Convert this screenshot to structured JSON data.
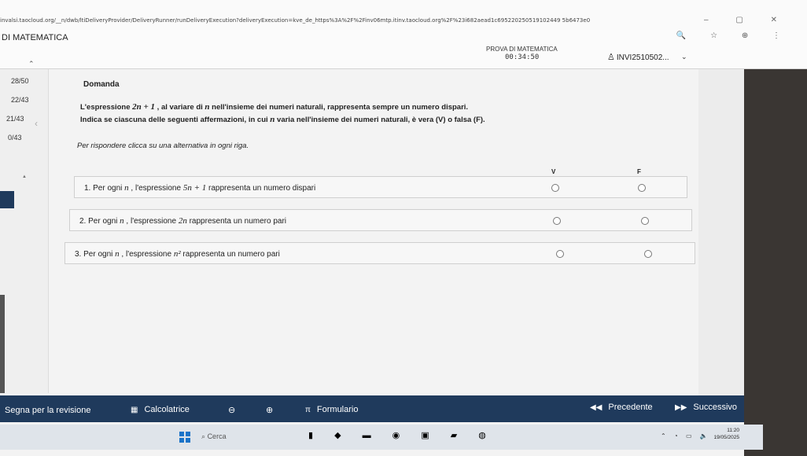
{
  "browser": {
    "url": "invalsi.taocloud.org/__n/dwb/ltiDeliveryProvider/DeliveryRunner/runDeliveryExecution?deliveryExecution=kve_de_https%3A%2F%2Finv06mtp.itinv.taocloud.org%2F%23i682aead1c695220250519102449 5b6473e0",
    "win_ctrls": "– ▢ ✕",
    "icons": "🔍 ☆ ⊕ ⋮"
  },
  "header": {
    "subject": "DI MATEMATICA",
    "test_title": "PROVA DI MATEMATICA",
    "timer": "00:34:50",
    "user": "INVI2510502...",
    "user_icon": "user-icon",
    "chevron": "⌄"
  },
  "sidebar": {
    "sections": [
      "28/50",
      "22/43",
      "21/43",
      "0/43"
    ],
    "up_arrow": "⌃",
    "collapse_arrow": "‹",
    "tiny_marker": "▲"
  },
  "question": {
    "title": "Domanda",
    "stem_line1_a": "L'espressione ",
    "stem_line1_math": "2n + 1",
    "stem_line1_b": " , al variare di ",
    "stem_line1_math2": "n",
    "stem_line1_c": " nell'insieme dei numeri naturali, rappresenta sempre un numero dispari.",
    "stem_line2_a": "Indica se ciascuna delle seguenti affermazioni, in cui ",
    "stem_line2_math": "n",
    "stem_line2_b": " varia nell'insieme dei numeri naturali, è vera (V) o falsa (F).",
    "instructions": "Per rispondere clicca su una alternativa in ogni riga.",
    "col_true": "V",
    "col_false": "F",
    "rows": [
      {
        "a": "1. Per ogni ",
        "m1": "n",
        "b": " , l'espressione ",
        "m2": "5n + 1",
        "c": " rappresenta un numero dispari"
      },
      {
        "a": "2. Per ogni ",
        "m1": "n",
        "b": " , l'espressione ",
        "m2": "2n",
        "c": " rappresenta un numero pari"
      },
      {
        "a": "3. Per ogni ",
        "m1": "n",
        "b": " , l'espressione ",
        "m2": "n²",
        "c": " rappresenta un numero pari"
      }
    ]
  },
  "bottombar": {
    "mark_review": "Segna per la revisione",
    "calculator": "Calcolatrice",
    "calculator_icon": "▦",
    "zoom_out_icon": "⊖",
    "zoom_in_icon": "⊕",
    "formulary_icon": "π",
    "formulary": "Formulario",
    "previous_icon": "◀◀",
    "previous": "Precedente",
    "next_icon": "▶▶",
    "next": "Successivo"
  },
  "taskbar": {
    "search": "Cerca",
    "search_icon": "⌕",
    "apps": "▮ ◆ ▬ ◉ ▣ ▰ ◍",
    "tray": "⌃ ◔ ▭ 🔈",
    "time": "11:20",
    "date": "19/05/2025"
  }
}
